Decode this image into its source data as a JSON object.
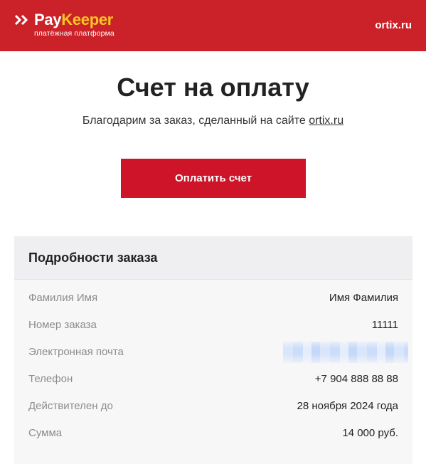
{
  "header": {
    "logo_pay": "Pay",
    "logo_keeper": "Keeper",
    "logo_subtitle": "платёжная платформа",
    "site": "ortix.ru",
    "background": "#cb2229",
    "logo_accent": "#f6c623",
    "chevron_icon": "double-chevron-right-icon"
  },
  "main": {
    "title": "Счет на оплату",
    "thanks_text": "Благодарим за заказ, сделанный на сайте ",
    "thanks_link": "ortix.ru",
    "pay_button_label": "Оплатить счет",
    "pay_button_color": "#cd1428"
  },
  "order": {
    "title": "Подробности заказа",
    "rows": [
      {
        "label": "Фамилия Имя",
        "value": "Имя Фамилия"
      },
      {
        "label": "Номер заказа",
        "value": "11111"
      },
      {
        "label": "Электронная почта",
        "value": ""
      },
      {
        "label": "Телефон",
        "value": "+7 904 888 88 88"
      },
      {
        "label": "Действителен до",
        "value": "28 ноября 2024 года"
      },
      {
        "label": "Сумма",
        "value": "14 000 руб."
      }
    ]
  }
}
